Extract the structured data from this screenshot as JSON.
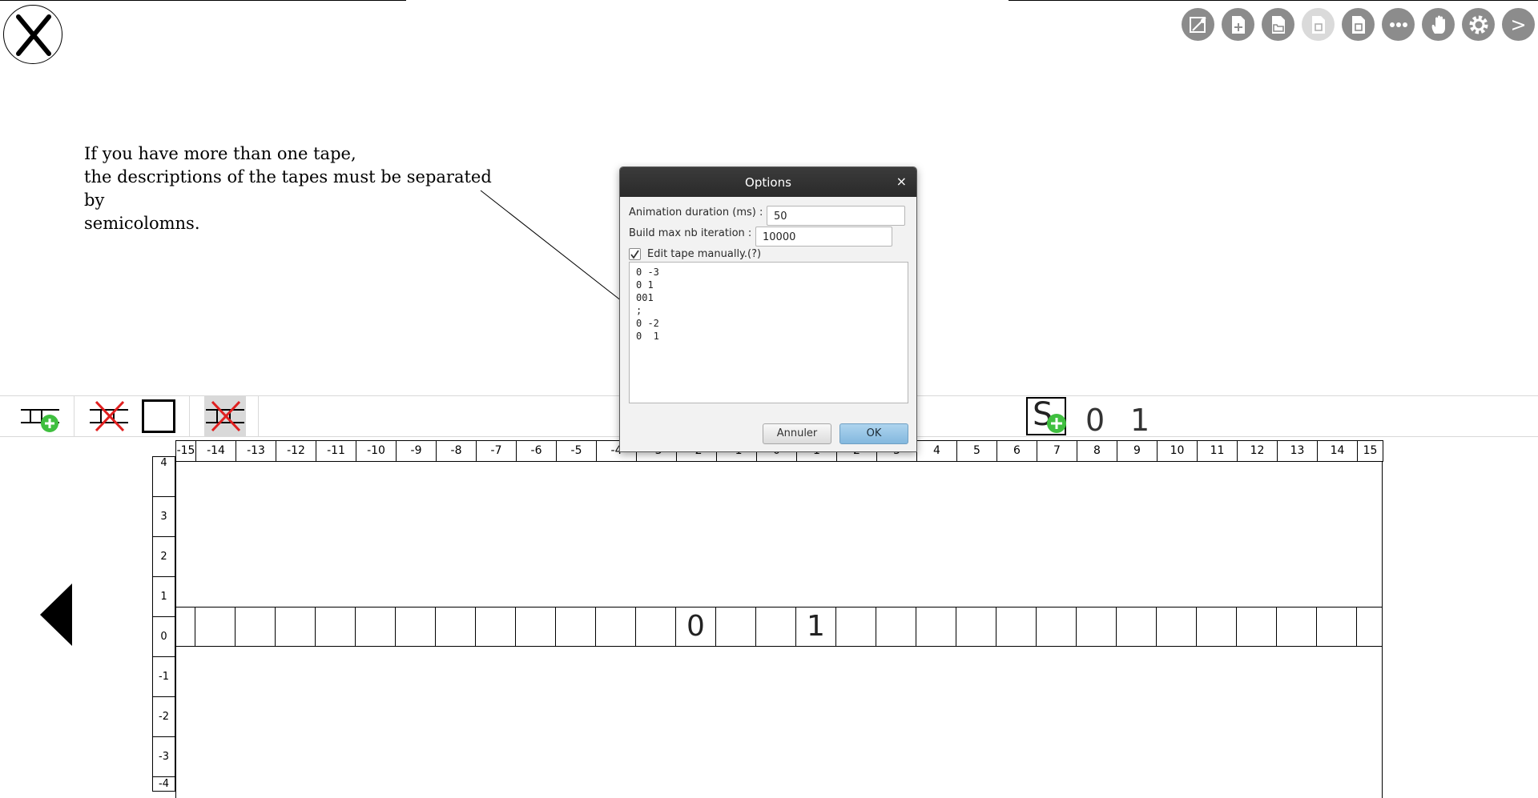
{
  "annotation": {
    "text": "If you have more than one tape,\nthe descriptions of the tapes must be separated by\nsemicolomns."
  },
  "toolbar": {
    "buttons": [
      {
        "name": "draw-icon"
      },
      {
        "name": "new-file-icon"
      },
      {
        "name": "open-folder-icon"
      },
      {
        "name": "save-icon",
        "disabled": true
      },
      {
        "name": "save-as-icon"
      },
      {
        "name": "more-icon"
      },
      {
        "name": "hand-icon"
      },
      {
        "name": "settings-icon"
      },
      {
        "name": "next-icon",
        "label": ">"
      }
    ]
  },
  "palette": {
    "symbols": [
      "0",
      "1"
    ],
    "state_symbol": "S"
  },
  "grid": {
    "columns": [
      "-15",
      "-14",
      "-13",
      "-12",
      "-11",
      "-10",
      "-9",
      "-8",
      "-7",
      "-6",
      "-5",
      "-4",
      "-3",
      "-2",
      "-1",
      "0",
      "1",
      "2",
      "3",
      "4",
      "5",
      "6",
      "7",
      "8",
      "9",
      "10",
      "11",
      "12",
      "13",
      "14",
      "15"
    ],
    "rows": [
      "4",
      "3",
      "2",
      "1",
      "0",
      "-1",
      "-2",
      "-3",
      "-4"
    ],
    "tape_cells": {
      "-2": "0",
      "1": "1"
    }
  },
  "dialog": {
    "title": "Options",
    "close_label": "×",
    "animation_label": "Animation duration (ms) :",
    "animation_value": "50",
    "build_label": "Build max nb iteration :",
    "build_value": "10000",
    "edit_manual_label": "Edit tape manually.(?)",
    "edit_manual_checked": true,
    "tape_text": "0 -3\n0 1\n001\n;\n0 -2\n0  1",
    "cancel_label": "Annuler",
    "ok_label": "OK"
  }
}
